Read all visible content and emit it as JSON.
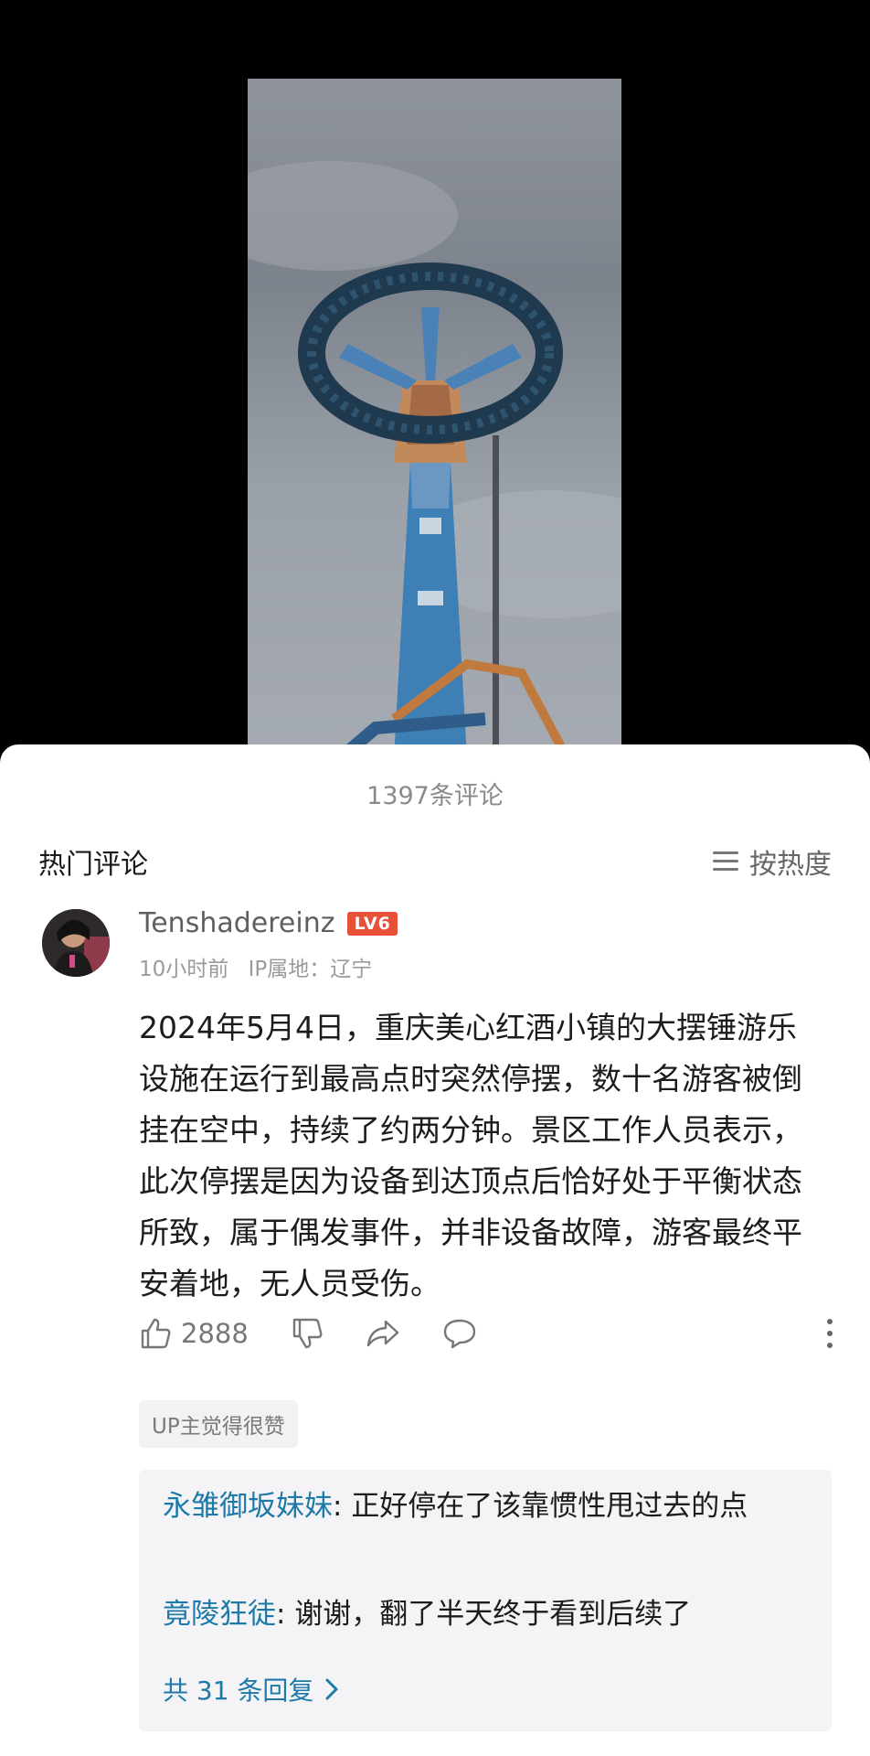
{
  "sheet": {
    "comment_count": "1397条评论",
    "section_title": "热门评论",
    "sort_label": "按热度"
  },
  "comment": {
    "username": "Tenshadereinz",
    "level": "LV6",
    "time": "10小时前",
    "ip": "IP属地：辽宁",
    "text": "2024年5月4日，重庆美心红酒小镇的大摆锤游乐设施在运行到最高点时突然停摆，数十名游客被倒挂在空中，持续了约两分钟。景区工作人员表示，此次停摆是因为设备到达顶点后恰好处于平衡状态所致，属于偶发事件，并非设备故障，游客最终平安着地，无人员受伤。",
    "likes": "2888",
    "up_badge": "UP主觉得很赞"
  },
  "replies": [
    {
      "user": "永雏御坂妹妹",
      "sep": ": ",
      "text": "正好停在了该靠惯性甩过去的点"
    },
    {
      "user": "竟陵狂徒",
      "sep": ": ",
      "text": "谢谢，翻了半天终于看到后续了"
    }
  ],
  "reply_more": "共 31 条回复",
  "colors": {
    "link": "#1d79a8",
    "level_badge": "#e8503a"
  },
  "icons": [
    "thumbs-up-icon",
    "thumbs-down-icon",
    "share-icon",
    "comment-bubble-icon",
    "more-vertical-icon",
    "sort-lines-icon",
    "chevron-right-icon"
  ]
}
